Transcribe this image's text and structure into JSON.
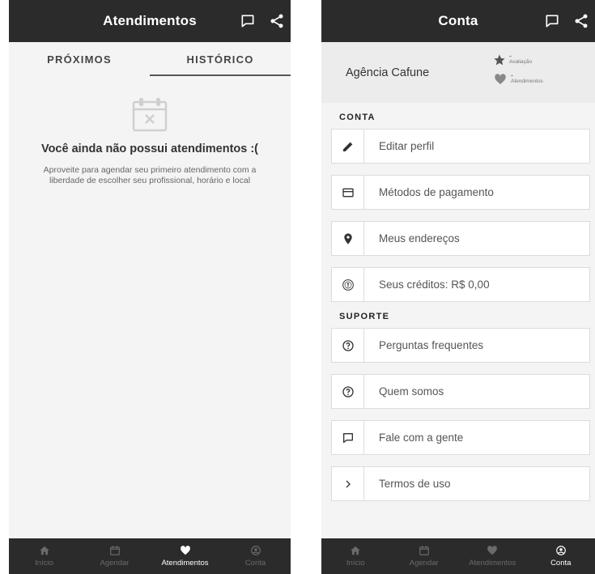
{
  "left_screen": {
    "title": "Atendimentos",
    "tabs": [
      "PRÓXIMOS",
      "HISTÓRICO"
    ],
    "empty_title": "Você ainda não possui atendimentos :(",
    "empty_desc_line1": "Aproveite para agendar seu primeiro atendimento com a",
    "empty_desc_line2": "liberdade de escolher seu profissional, horário e local"
  },
  "right_screen": {
    "title": "Conta",
    "profile_name": "Agência Cafune",
    "rating_value": "-",
    "rating_label": "Avaliação",
    "appointments_value": "-",
    "appointments_label": "Atendimentos",
    "section_account": "CONTA",
    "section_support": "SUPORTE",
    "account_items": [
      {
        "label": "Editar perfil",
        "icon": "pencil-icon"
      },
      {
        "label": "Métodos de pagamento",
        "icon": "credit-card-icon"
      },
      {
        "label": "Meus endereços",
        "icon": "location-pin-icon"
      },
      {
        "label": "Seus créditos: R$ 0,00",
        "icon": "credits-coin-icon"
      }
    ],
    "support_items": [
      {
        "label": "Perguntas frequentes",
        "icon": "question-icon"
      },
      {
        "label": "Quem somos",
        "icon": "question-icon"
      },
      {
        "label": "Fale com a gente",
        "icon": "chat-icon"
      },
      {
        "label": "Termos de uso",
        "icon": "chevron-right-icon"
      }
    ]
  },
  "bottom_nav": [
    "Início",
    "Agendar",
    "Atendimentos",
    "Conta"
  ],
  "left_active_nav": "Atendimentos",
  "right_active_nav": "Conta",
  "colors": {
    "appbar": "#2b2b2b",
    "background": "#f4f4f4",
    "nav_inactive": "#6a6a6a",
    "nav_active": "#ffffff"
  }
}
